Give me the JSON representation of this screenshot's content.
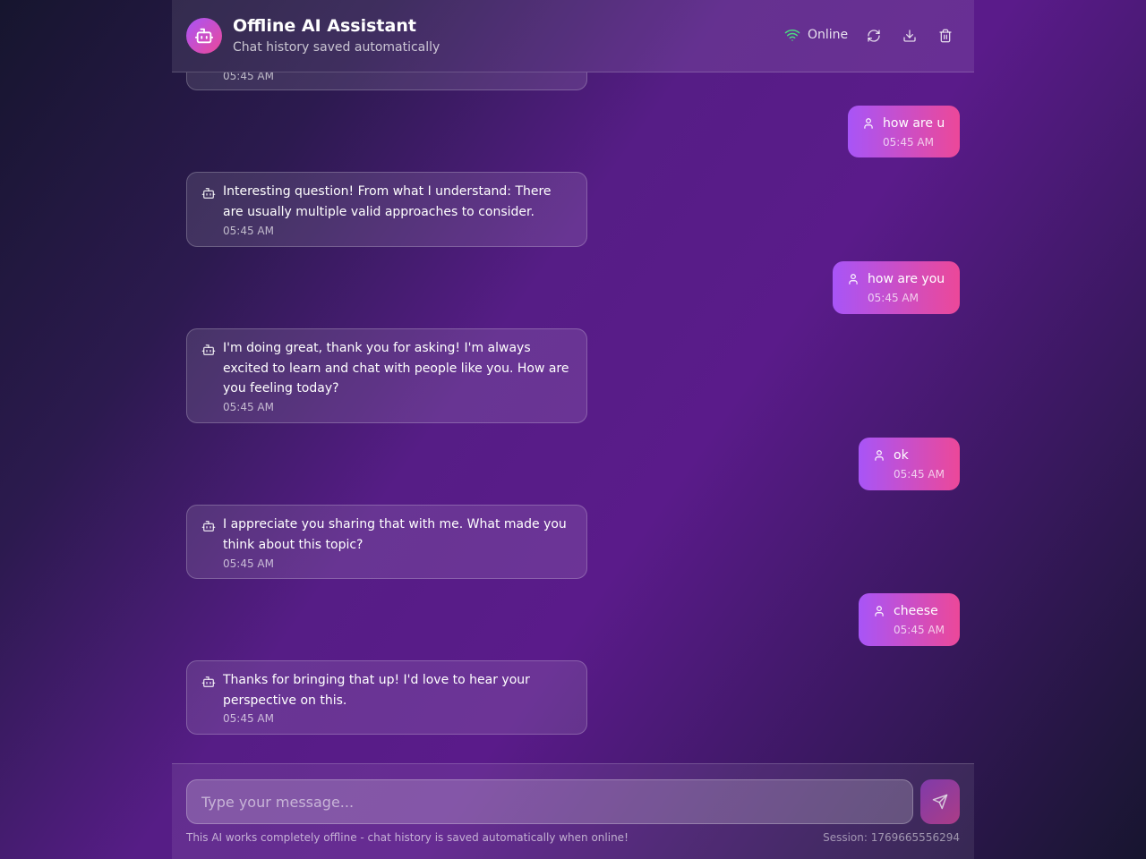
{
  "header": {
    "title": "Offline AI Assistant",
    "subtitle": "Chat history saved automatically",
    "status": "Online",
    "logo_icon": "bot-icon",
    "status_icon": "wifi-icon",
    "actions": [
      "refresh-icon",
      "download-icon",
      "trash-icon"
    ]
  },
  "messages": [
    {
      "role": "bot",
      "text": "",
      "time": "05:45 AM"
    },
    {
      "role": "user",
      "text": "how are u",
      "time": "05:45 AM"
    },
    {
      "role": "bot",
      "text": "Interesting question! From what I understand: There are usually multiple valid approaches to consider.",
      "time": "05:45 AM"
    },
    {
      "role": "user",
      "text": "how are you",
      "time": "05:45 AM"
    },
    {
      "role": "bot",
      "text": "I'm doing great, thank you for asking! I'm always excited to learn and chat with people like you. How are you feeling today?",
      "time": "05:45 AM"
    },
    {
      "role": "user",
      "text": "ok",
      "time": "05:45 AM"
    },
    {
      "role": "bot",
      "text": "I appreciate you sharing that with me. What made you think about this topic?",
      "time": "05:45 AM"
    },
    {
      "role": "user",
      "text": "cheese",
      "time": "05:45 AM"
    },
    {
      "role": "bot",
      "text": "Thanks for bringing that up! I'd love to hear your perspective on this.",
      "time": "05:45 AM"
    }
  ],
  "composer": {
    "placeholder": "Type your message...",
    "send_icon": "send-icon"
  },
  "footer": {
    "note": "This AI works completely offline - chat history is saved automatically when online!",
    "session": "Session: 1769665556294"
  },
  "colors": {
    "accent_start": "#a855f7",
    "accent_end": "#ec4899",
    "online": "#4ade80"
  }
}
